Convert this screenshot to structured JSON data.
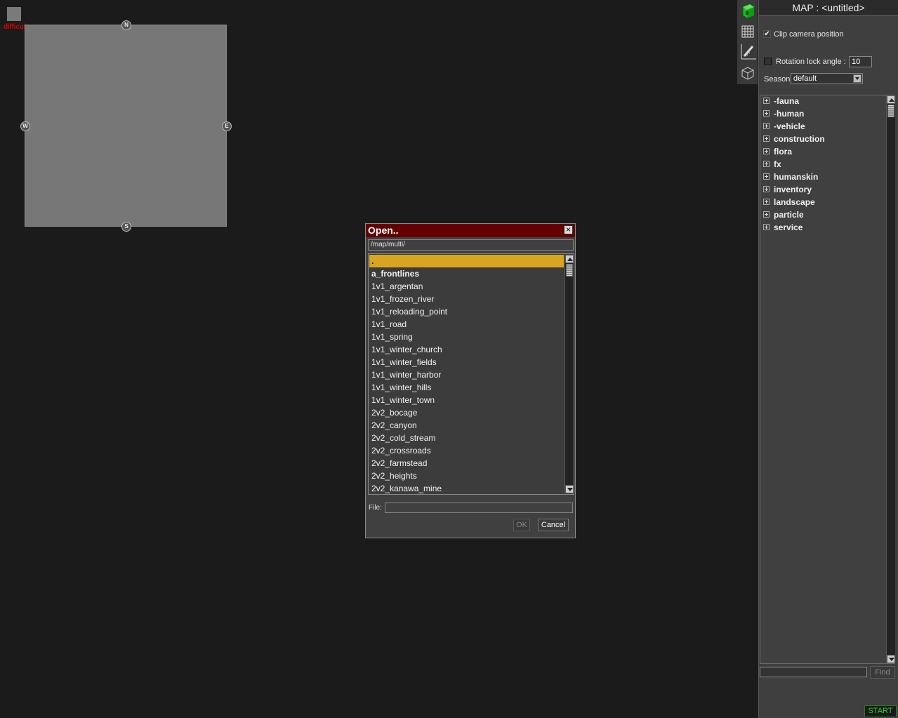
{
  "minimap": {
    "difficulty": "difficulty: none",
    "compass": {
      "n": "N",
      "s": "S",
      "e": "E",
      "w": "W"
    }
  },
  "tools": [
    "cube-green-icon",
    "grid-icon",
    "measure-tool-icon",
    "wireframe-box-icon"
  ],
  "right_panel": {
    "title": "MAP : <untitled>",
    "clip_camera": {
      "label": "Clip camera position",
      "checked": true,
      "mark": "✔"
    },
    "rotation_lock": {
      "label": "Rotation lock angle :",
      "checked": false,
      "value": "10"
    },
    "season": {
      "label": "Season:",
      "value": "default"
    },
    "tree": [
      "-fauna",
      "-human",
      "-vehicle",
      "construction",
      "flora",
      "fx",
      "humanskin",
      "inventory",
      "landscape",
      "particle",
      "service"
    ],
    "find_button": "Find",
    "start_button": "START"
  },
  "dialog": {
    "title": "Open..",
    "close": "×",
    "path": "/map/multi/",
    "files": [
      ".",
      "a_frontlines",
      "1v1_argentan",
      "1v1_frozen_river",
      "1v1_reloading_point",
      "1v1_road",
      "1v1_spring",
      "1v1_winter_church",
      "1v1_winter_fields",
      "1v1_winter_harbor",
      "1v1_winter_hills",
      "1v1_winter_town",
      "2v2_bocage",
      "2v2_canyon",
      "2v2_cold_stream",
      "2v2_crossroads",
      "2v2_farmstead",
      "2v2_heights",
      "2v2_kanawa_mine"
    ],
    "selected_index": 0,
    "file_label": "File:",
    "file_value": "",
    "ok": "OK",
    "cancel": "Cancel"
  },
  "colors": {
    "background": "#1b1b1b",
    "dialog_title": "#650000",
    "selection": "#d9a520",
    "difficulty_text": "#d40000",
    "start_text": "#2fd12f"
  }
}
